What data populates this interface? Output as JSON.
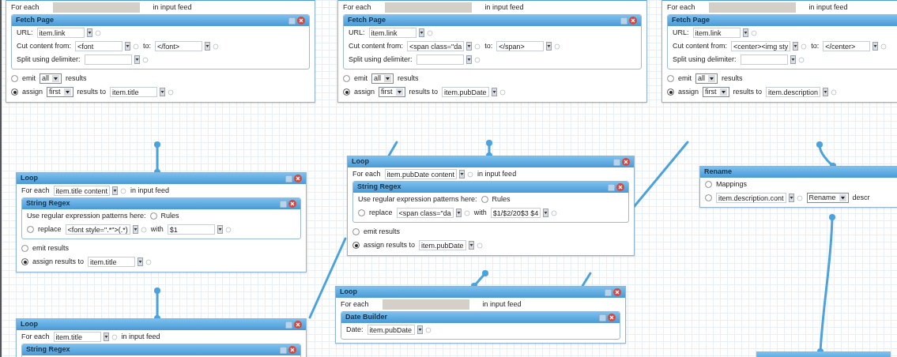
{
  "modules": [
    {
      "kind": "loop",
      "rows": [
        {
          "parts": [
            {
              "kind": "text",
              "text": "For each"
            },
            {
              "kind": "gray-field"
            },
            {
              "kind": "text",
              "text": "in input feed"
            }
          ]
        }
      ],
      "sub": {
        "title": "Fetch Page",
        "rows": [
          {
            "parts": [
              {
                "kind": "text",
                "text": "URL:"
              },
              {
                "kind": "field",
                "value": "item.link"
              }
            ]
          },
          {
            "parts": [
              {
                "kind": "text",
                "text": "Cut content from:"
              },
              {
                "kind": "field",
                "value": "<font"
              },
              {
                "kind": "text",
                "text": "to:"
              },
              {
                "kind": "field",
                "value": "</font>"
              }
            ]
          },
          {
            "parts": [
              {
                "kind": "text",
                "text": "Split using delimiter:"
              },
              {
                "kind": "field"
              }
            ]
          }
        ]
      },
      "footer": [
        {
          "parts": [
            {
              "kind": "radio",
              "selected": false
            },
            {
              "kind": "text",
              "text": "emit"
            },
            {
              "kind": "select",
              "value": "all"
            },
            {
              "kind": "text",
              "text": "results"
            }
          ]
        },
        {
          "parts": [
            {
              "kind": "radio",
              "selected": true
            },
            {
              "kind": "text",
              "text": "assign"
            },
            {
              "kind": "select",
              "value": "first"
            },
            {
              "kind": "text",
              "text": "results to"
            },
            {
              "kind": "field",
              "value": "item.title"
            }
          ]
        }
      ]
    },
    {
      "kind": "loop",
      "rows": [
        {
          "parts": [
            {
              "kind": "text",
              "text": "For each"
            },
            {
              "kind": "gray-field"
            },
            {
              "kind": "text",
              "text": "in input feed"
            }
          ]
        }
      ],
      "sub": {
        "title": "Fetch Page",
        "rows": [
          {
            "parts": [
              {
                "kind": "text",
                "text": "URL:"
              },
              {
                "kind": "field",
                "value": "item.link"
              }
            ]
          },
          {
            "parts": [
              {
                "kind": "text",
                "text": "Cut content from:"
              },
              {
                "kind": "field",
                "value": "<span class=\"da"
              },
              {
                "kind": "text",
                "text": "to:"
              },
              {
                "kind": "field",
                "value": "</span>"
              }
            ]
          },
          {
            "parts": [
              {
                "kind": "text",
                "text": "Split using delimiter:"
              },
              {
                "kind": "field"
              }
            ]
          }
        ]
      },
      "footer": [
        {
          "parts": [
            {
              "kind": "radio",
              "selected": false
            },
            {
              "kind": "text",
              "text": "emit"
            },
            {
              "kind": "select",
              "value": "all"
            },
            {
              "kind": "text",
              "text": "results"
            }
          ]
        },
        {
          "parts": [
            {
              "kind": "radio",
              "selected": true
            },
            {
              "kind": "text",
              "text": "assign"
            },
            {
              "kind": "select",
              "value": "first"
            },
            {
              "kind": "text",
              "text": "results to"
            },
            {
              "kind": "field",
              "value": "item.pubDate"
            }
          ]
        }
      ]
    },
    {
      "kind": "loop",
      "rows": [
        {
          "parts": [
            {
              "kind": "text",
              "text": "For each"
            },
            {
              "kind": "gray-field"
            },
            {
              "kind": "text",
              "text": "in input feed"
            }
          ]
        }
      ],
      "sub": {
        "title": "Fetch Page",
        "rows": [
          {
            "parts": [
              {
                "kind": "text",
                "text": "URL:"
              },
              {
                "kind": "field",
                "value": "item.link"
              }
            ]
          },
          {
            "parts": [
              {
                "kind": "text",
                "text": "Cut content from:"
              },
              {
                "kind": "field",
                "value": "<center><img sty"
              },
              {
                "kind": "text",
                "text": "to:"
              },
              {
                "kind": "field",
                "value": "</center>"
              }
            ]
          },
          {
            "parts": [
              {
                "kind": "text",
                "text": "Split using delimiter:"
              },
              {
                "kind": "field"
              }
            ]
          }
        ]
      },
      "footer": [
        {
          "parts": [
            {
              "kind": "radio",
              "selected": false
            },
            {
              "kind": "text",
              "text": "emit"
            },
            {
              "kind": "select",
              "value": "all"
            },
            {
              "kind": "text",
              "text": "results"
            }
          ]
        },
        {
          "parts": [
            {
              "kind": "radio",
              "selected": true
            },
            {
              "kind": "text",
              "text": "assign"
            },
            {
              "kind": "select",
              "value": "first"
            },
            {
              "kind": "text",
              "text": "results to"
            },
            {
              "kind": "field",
              "value": "item.description"
            }
          ]
        }
      ]
    },
    {
      "kind": "loop",
      "title": "Loop",
      "rows": [
        {
          "parts": [
            {
              "kind": "text",
              "text": "For each"
            },
            {
              "kind": "field",
              "value": "item.title content"
            },
            {
              "kind": "text",
              "text": "in input feed"
            }
          ]
        }
      ],
      "sub": {
        "title": "String Regex",
        "rows": [
          {
            "parts": [
              {
                "kind": "text",
                "text": "Use regular expression patterns here:"
              },
              {
                "kind": "radio",
                "selected": false
              },
              {
                "kind": "text",
                "text": "Rules"
              }
            ]
          },
          {
            "parts": [
              {
                "kind": "radio",
                "selected": false
              },
              {
                "kind": "text",
                "text": "replace"
              },
              {
                "kind": "field",
                "value": "<font style=\".*\">(.*)"
              },
              {
                "kind": "text",
                "text": "with"
              },
              {
                "kind": "field",
                "value": "$1"
              }
            ]
          }
        ]
      },
      "footer": [
        {
          "parts": [
            {
              "kind": "radio",
              "selected": false
            },
            {
              "kind": "text",
              "text": "emit results"
            }
          ]
        },
        {
          "parts": [
            {
              "kind": "radio",
              "selected": true
            },
            {
              "kind": "text",
              "text": "assign results to"
            },
            {
              "kind": "field",
              "value": "item.title"
            }
          ]
        }
      ]
    },
    {
      "kind": "loop",
      "title": "Loop",
      "rows": [
        {
          "parts": [
            {
              "kind": "text",
              "text": "For each"
            },
            {
              "kind": "field",
              "value": "item.title"
            },
            {
              "kind": "text",
              "text": "in input feed"
            }
          ]
        }
      ],
      "sub": {
        "title": "String Regex"
      }
    },
    {
      "kind": "loop",
      "title": "Loop",
      "rows": [
        {
          "parts": [
            {
              "kind": "text",
              "text": "For each"
            },
            {
              "kind": "field",
              "value": "item.pubDate content"
            },
            {
              "kind": "text",
              "text": "in input feed"
            }
          ]
        }
      ],
      "sub": {
        "title": "String Regex",
        "rows": [
          {
            "parts": [
              {
                "kind": "text",
                "text": "Use regular expression patterns here:"
              },
              {
                "kind": "radio",
                "selected": false
              },
              {
                "kind": "text",
                "text": "Rules"
              }
            ]
          },
          {
            "parts": [
              {
                "kind": "radio",
                "selected": false
              },
              {
                "kind": "text",
                "text": "replace"
              },
              {
                "kind": "field",
                "value": "<span class=\"da"
              },
              {
                "kind": "text",
                "text": "with"
              },
              {
                "kind": "field",
                "value": "$1/$2/20$3 $4"
              }
            ]
          }
        ]
      },
      "footer": [
        {
          "parts": [
            {
              "kind": "radio",
              "selected": false
            },
            {
              "kind": "text",
              "text": "emit results"
            }
          ]
        },
        {
          "parts": [
            {
              "kind": "radio",
              "selected": true
            },
            {
              "kind": "text",
              "text": "assign results to"
            },
            {
              "kind": "field",
              "value": "item.pubDate"
            }
          ]
        }
      ]
    },
    {
      "kind": "loop",
      "title": "Loop",
      "rows": [
        {
          "parts": [
            {
              "kind": "text",
              "text": "For each"
            },
            {
              "kind": "gray-field"
            },
            {
              "kind": "text",
              "text": "in input feed"
            }
          ]
        }
      ],
      "sub": {
        "title": "Date Builder",
        "rows": [
          {
            "parts": [
              {
                "kind": "text",
                "text": "Date:"
              },
              {
                "kind": "field",
                "value": "item.pubDate"
              }
            ]
          }
        ]
      }
    },
    {
      "kind": "rename",
      "title": "Rename",
      "rows": [
        {
          "parts": [
            {
              "kind": "radio",
              "selected": false
            },
            {
              "kind": "text",
              "text": "Mappings"
            }
          ]
        },
        {
          "parts": [
            {
              "kind": "radio",
              "selected": false
            },
            {
              "kind": "field",
              "value": "item.description.cont"
            },
            {
              "kind": "select",
              "value": "Rename"
            },
            {
              "kind": "text",
              "text": "descr"
            }
          ]
        }
      ]
    },
    {
      "kind": "output"
    }
  ]
}
